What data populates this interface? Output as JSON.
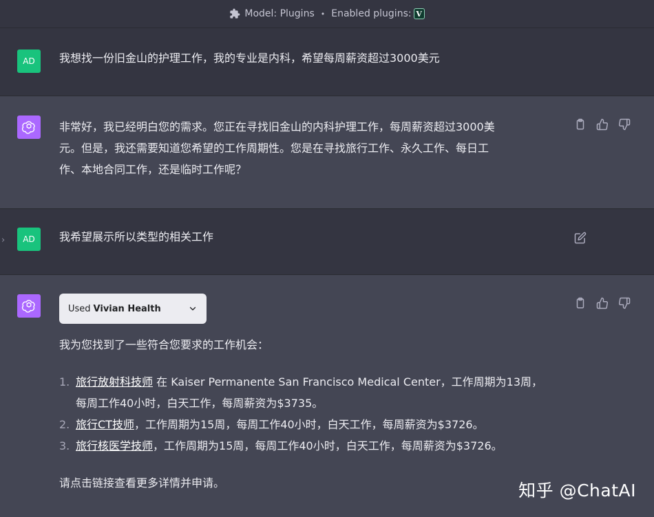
{
  "topbar": {
    "model_label": "Model: Plugins",
    "separator": "•",
    "enabled_label": "Enabled plugins:",
    "plugin_icon_letter": "V"
  },
  "messages": [
    {
      "role": "user",
      "avatar_text": "AD",
      "text": "我想找一份旧金山的护理工作，我的专业是内科，希望每周薪资超过3000美元"
    },
    {
      "role": "assistant",
      "lines": [
        "非常好，我已经明白您的需求。您正在寻找旧金山的内科护理工作，每周薪资超过3000美",
        "元。但是，我还需要知道您希望的工作周期性。您是在寻找旅行工作、永久工作、每日工",
        "作、本地合同工作，还是临时工作呢？"
      ]
    },
    {
      "role": "user",
      "avatar_text": "AD",
      "text": "我希望展示所以类型的相关工作",
      "collapse_glyph": "›"
    },
    {
      "role": "assistant",
      "plugin_used_label": "Used",
      "plugin_name": "Vivian Health",
      "intro": "我为您找到了一些符合您要求的工作机会：",
      "jobs": [
        {
          "num": "1.",
          "link": "旅行放射科技师",
          "rest_line1": " 在 Kaiser Permanente San Francisco Medical Center，工作周期为13周，",
          "rest_line2": "每周工作40小时，白天工作，每周薪资为$3735。"
        },
        {
          "num": "2.",
          "link": "旅行CT技师",
          "rest_line1": "，工作周期为15周，每周工作40小时，白天工作，每周薪资为$3726。"
        },
        {
          "num": "3.",
          "link": "旅行核医学技师",
          "rest_line1": "，工作周期为15周，每周工作40小时，白天工作，每周薪资为$3726。"
        }
      ],
      "outro": "请点击链接查看更多详情并申请。"
    }
  ],
  "watermark": "知乎 @ChatAI",
  "colors": {
    "user_bg": "#343541",
    "assistant_bg": "#444654",
    "user_avatar": "#19c37d",
    "gpt_avatar": "#ab68ff"
  },
  "icons": {
    "topbar": "puzzle-icon",
    "actions": [
      "clipboard-icon",
      "thumbs-up-icon",
      "thumbs-down-icon"
    ],
    "edit": "edit-icon",
    "dropdown": "chevron-down-icon"
  }
}
